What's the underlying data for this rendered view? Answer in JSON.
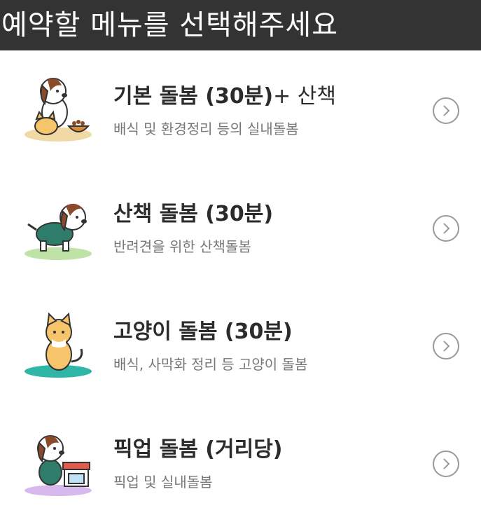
{
  "header": {
    "title": "예약할 메뉴를 선택해주세요"
  },
  "menu": [
    {
      "title": "기본 돌봄 (30분)",
      "title_suffix": "+ 산책",
      "subtitle": "배식 및 환경정리 등의 실내돌봄",
      "icon": "dog-and-cat-feeding-icon",
      "base_color": "#f1d9a5"
    },
    {
      "title": "산책 돌봄 (30분)",
      "title_suffix": "",
      "subtitle": "반려견을 위한 산책돌봄",
      "icon": "walking-dog-icon",
      "base_color": "#bfe3a6"
    },
    {
      "title": "고양이 돌봄 (30분)",
      "title_suffix": "",
      "subtitle": "배식, 사막화 정리 등 고양이 돌봄",
      "icon": "cat-icon",
      "base_color": "#2fb6a7"
    },
    {
      "title": "픽업 돌봄 (거리당)",
      "title_suffix": "",
      "subtitle": "픽업 및 실내돌봄",
      "icon": "dog-pickup-icon",
      "base_color": "#d8b9ee"
    }
  ]
}
